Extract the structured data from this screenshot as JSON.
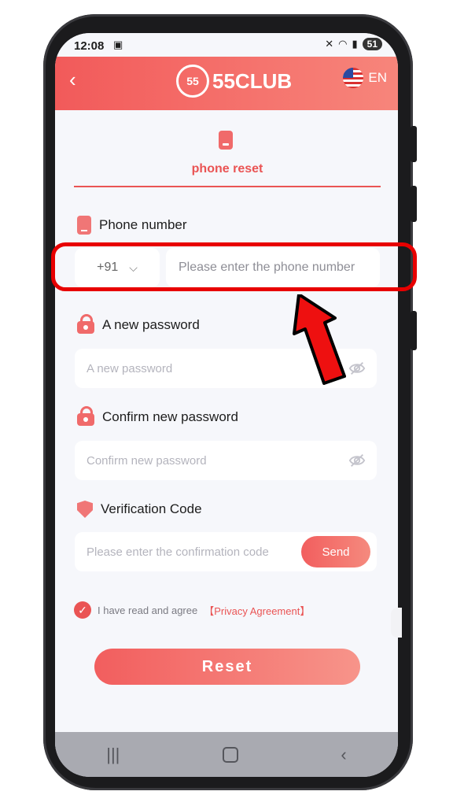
{
  "status_bar": {
    "time": "12:08",
    "battery": "51"
  },
  "header": {
    "logo_badge": "55",
    "logo_text": "55CLUB",
    "language": "EN"
  },
  "tab": {
    "label": "phone reset"
  },
  "phone_section": {
    "label": "Phone number",
    "country_code": "+91",
    "placeholder": "Please enter the phone number"
  },
  "new_password": {
    "label": "A new password",
    "placeholder": "A new password"
  },
  "confirm_password": {
    "label": "Confirm new password",
    "placeholder": "Confirm new password"
  },
  "verification": {
    "label": "Verification Code",
    "placeholder": "Please enter the confirmation code",
    "send_label": "Send"
  },
  "agreement": {
    "text": "I have read and agree",
    "link": "【Privacy Agreement】"
  },
  "reset_button": {
    "label": "Reset"
  },
  "colors": {
    "accent": "#ea5454",
    "header_start": "#f25a5a",
    "header_end": "#f7857b",
    "annotation": "#e80000"
  },
  "icons": [
    "back-icon",
    "flag-icon",
    "phone-icon",
    "lock-icon",
    "eye-off-icon",
    "shield-icon",
    "check-icon",
    "chevron-down-icon"
  ]
}
